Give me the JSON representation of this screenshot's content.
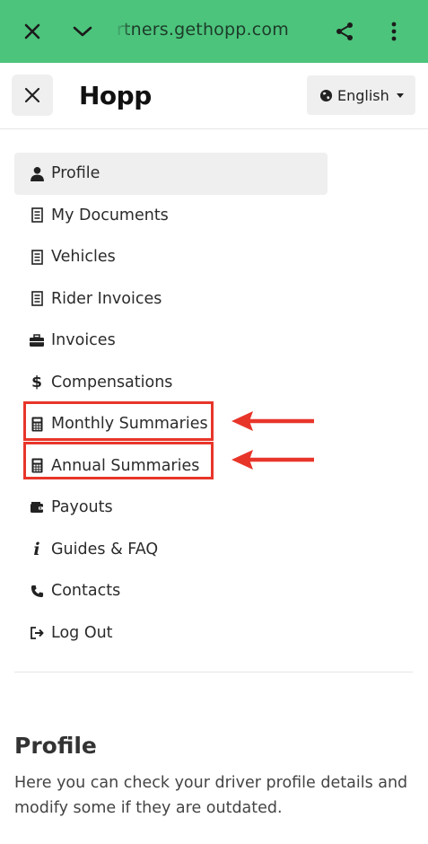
{
  "browser": {
    "url": "rtners.gethopp.com",
    "close_icon": "close-icon",
    "dropdown_icon": "chevron-down-icon",
    "share_icon": "share-icon",
    "menu_icon": "more-vertical-icon"
  },
  "header": {
    "brand": "Hopp",
    "language": "English",
    "close_icon": "close-icon",
    "globe_icon": "globe-icon"
  },
  "menu": {
    "items": [
      {
        "label": "Profile",
        "icon": "user-icon",
        "active": true
      },
      {
        "label": "My Documents",
        "icon": "document-icon"
      },
      {
        "label": "Vehicles",
        "icon": "document-icon"
      },
      {
        "label": "Rider Invoices",
        "icon": "document-icon"
      },
      {
        "label": "Invoices",
        "icon": "briefcase-icon"
      },
      {
        "label": "Compensations",
        "icon": "dollar-icon"
      },
      {
        "label": "Monthly Summaries",
        "icon": "calculator-icon",
        "highlighted": true
      },
      {
        "label": "Annual Summaries",
        "icon": "calculator-icon",
        "highlighted": true
      },
      {
        "label": "Payouts",
        "icon": "wallet-icon"
      },
      {
        "label": "Guides & FAQ",
        "icon": "info-icon"
      },
      {
        "label": "Contacts",
        "icon": "phone-icon"
      },
      {
        "label": "Log Out",
        "icon": "logout-icon"
      }
    ]
  },
  "section": {
    "title": "Profile",
    "description": "Here you can check your driver profile details and modify some if they are outdated."
  },
  "colors": {
    "browser_bar": "#4cc47c",
    "highlight": "#e8352a",
    "active_bg": "#efefef"
  }
}
